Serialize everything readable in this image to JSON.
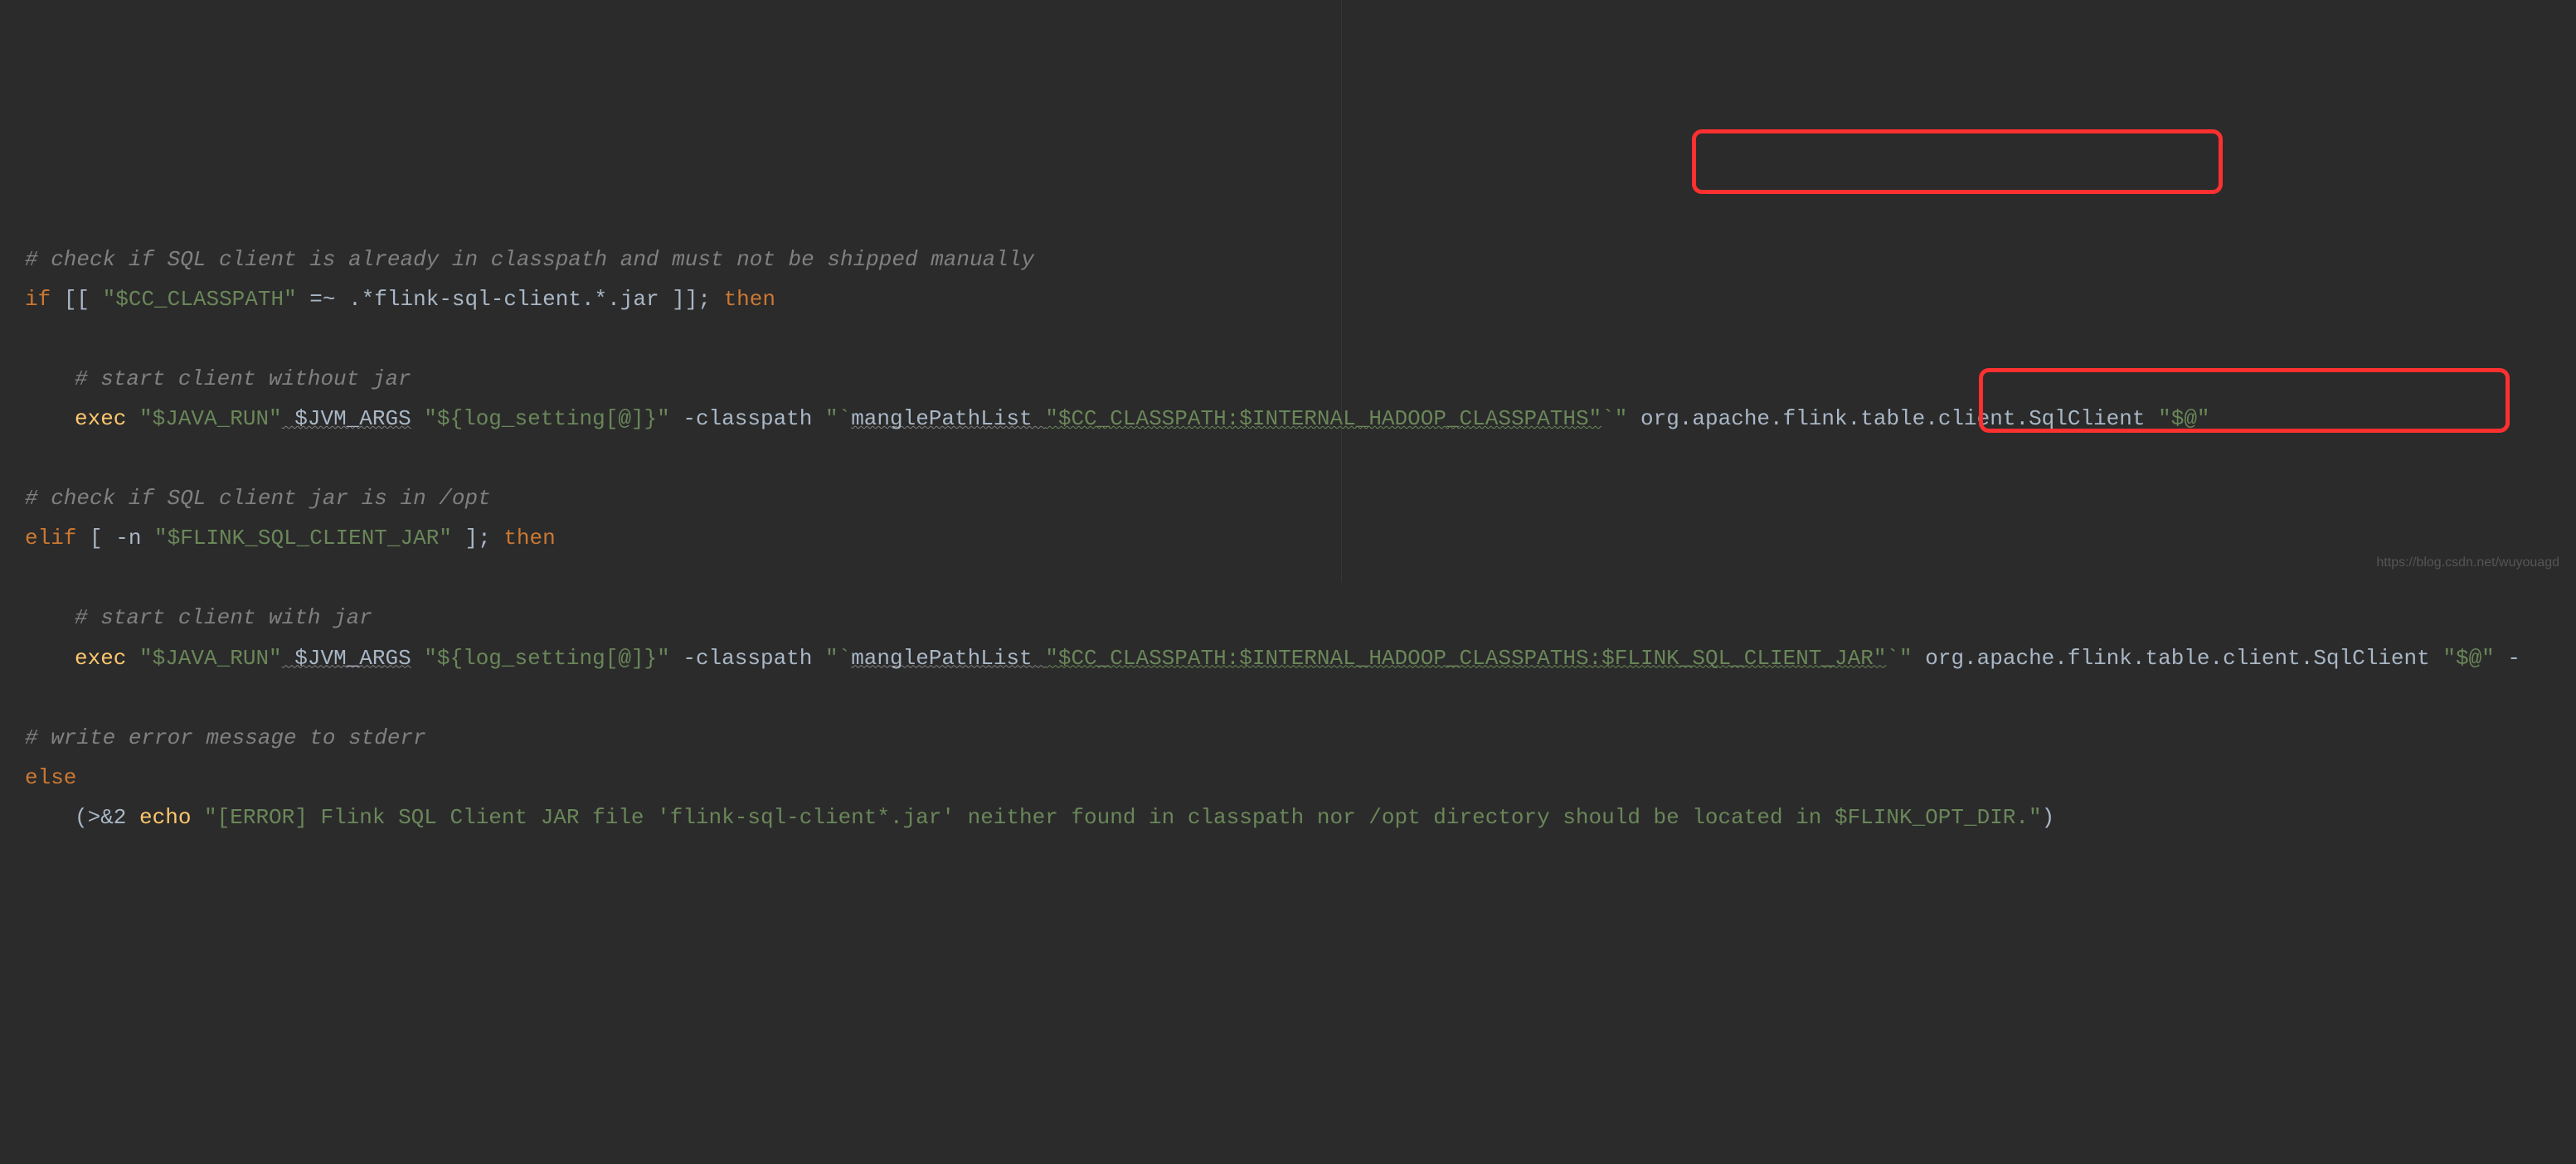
{
  "lines": {
    "l1": "# check if SQL client is already in classpath and must not be shipped manually",
    "l2_if": "if",
    "l2_bracket_open": " [[ ",
    "l2_str1": "\"$CC_CLASSPATH\"",
    "l2_op": " =~ .*flink-sql-client.*.jar ]]; ",
    "l2_then": "then",
    "l3": "# start client without jar",
    "l4_exec": "exec",
    "l4_str_java": " \"$JAVA_RUN\"",
    "l4_jvm": " $JVM_ARGS",
    "l4_str_log": " \"${log_setting[@]}\"",
    "l4_flag": " -classpath ",
    "l4_str_open": "\"`",
    "l4_mangle": "manglePathList ",
    "l4_str_path": "\"$CC_CLASSPATH:$INTERNAL_HADOOP_CLASSPATHS\"",
    "l4_str_close": "`\"",
    "l4_class": " org.apache.flink.table.client.SqlClient ",
    "l4_str_args": "\"$@\"",
    "l5": "# check if SQL client jar is in /opt",
    "l6_elif": "elif",
    "l6_bracket": " [ -n ",
    "l6_str": "\"$FLINK_SQL_CLIENT_JAR\"",
    "l6_close": " ]; ",
    "l6_then": "then",
    "l7": "# start client with jar",
    "l8_exec": "exec",
    "l8_str_java": " \"$JAVA_RUN\"",
    "l8_jvm": " $JVM_ARGS",
    "l8_str_log": " \"${log_setting[@]}\"",
    "l8_flag": " -classpath ",
    "l8_str_open": "\"`",
    "l8_mangle": "manglePathList ",
    "l8_str_path": "\"$CC_CLASSPATH:$INTERNAL_HADOOP_CLASSPATHS:$FLINK_SQL_CLIENT_JAR\"",
    "l8_str_close": "`\"",
    "l8_class": " org.apache.flink.table.client.SqlClient ",
    "l8_str_args": "\"$@\"",
    "l8_trail": " -",
    "l9": "# write error message to stderr",
    "l10_else": "else",
    "l11_open": "(>&2 ",
    "l11_echo": "echo",
    "l11_str": " \"[ERROR] Flink SQL Client JAR file 'flink-sql-client*.jar' neither found in classpath nor /opt directory should be located in $FLINK_OPT_DIR.\"",
    "l11_close": ")"
  },
  "watermark": "https://blog.csdn.net/wuyouagd"
}
